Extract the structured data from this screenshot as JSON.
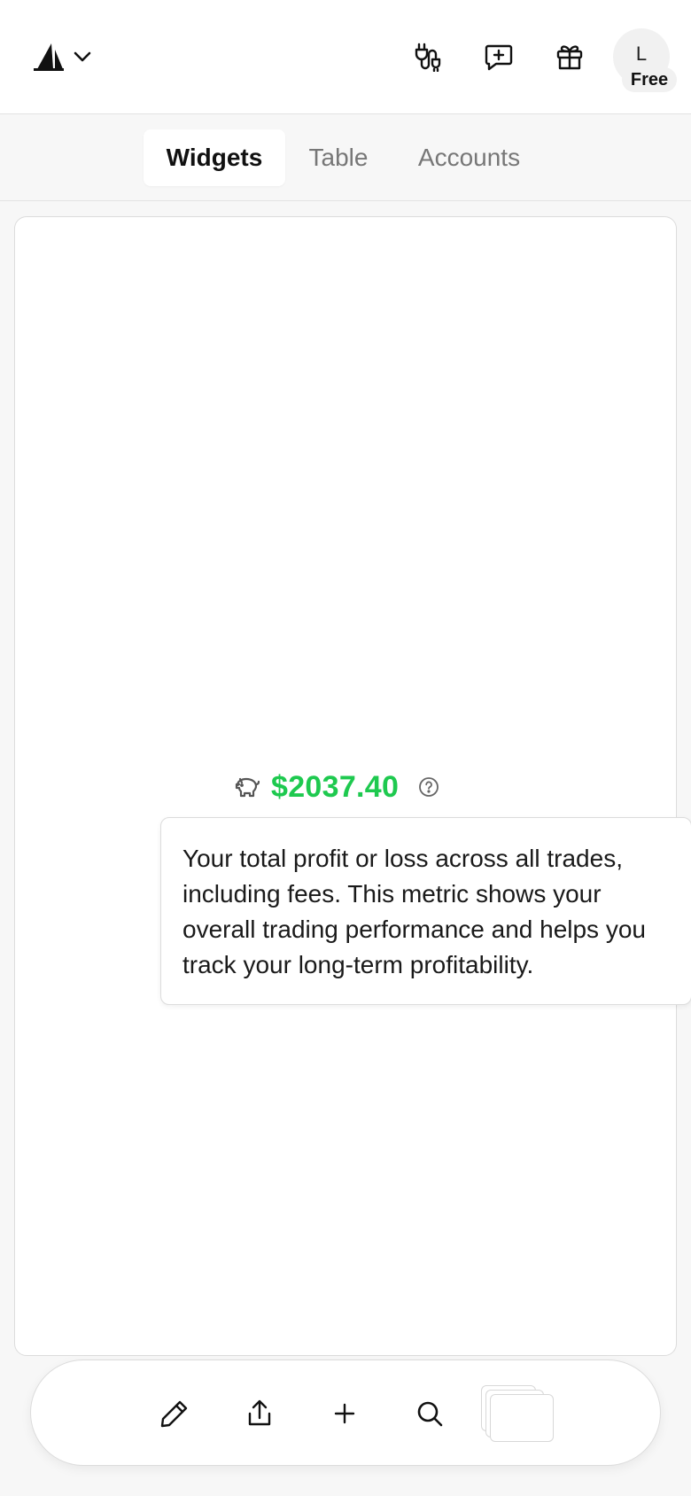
{
  "header": {
    "plan_badge": "Free",
    "avatar_initial": "L",
    "icons": [
      "plug-icon",
      "feedback-icon",
      "gift-icon"
    ]
  },
  "tabs": [
    {
      "label": "Widgets",
      "active": true
    },
    {
      "label": "Table",
      "active": false
    },
    {
      "label": "Accounts",
      "active": false
    }
  ],
  "widget": {
    "metric_value": "$2037.40",
    "metric_icon": "piggy-bank-icon",
    "value_color": "#1ec94f",
    "tooltip": "Your total profit or loss across all trades, including fees. This metric shows your overall trading performance and helps you track your long-term profitability."
  },
  "toolbar": {
    "icons": [
      "pencil-icon",
      "share-icon",
      "plus-icon",
      "search-icon",
      "layouts-stack-icon"
    ]
  }
}
